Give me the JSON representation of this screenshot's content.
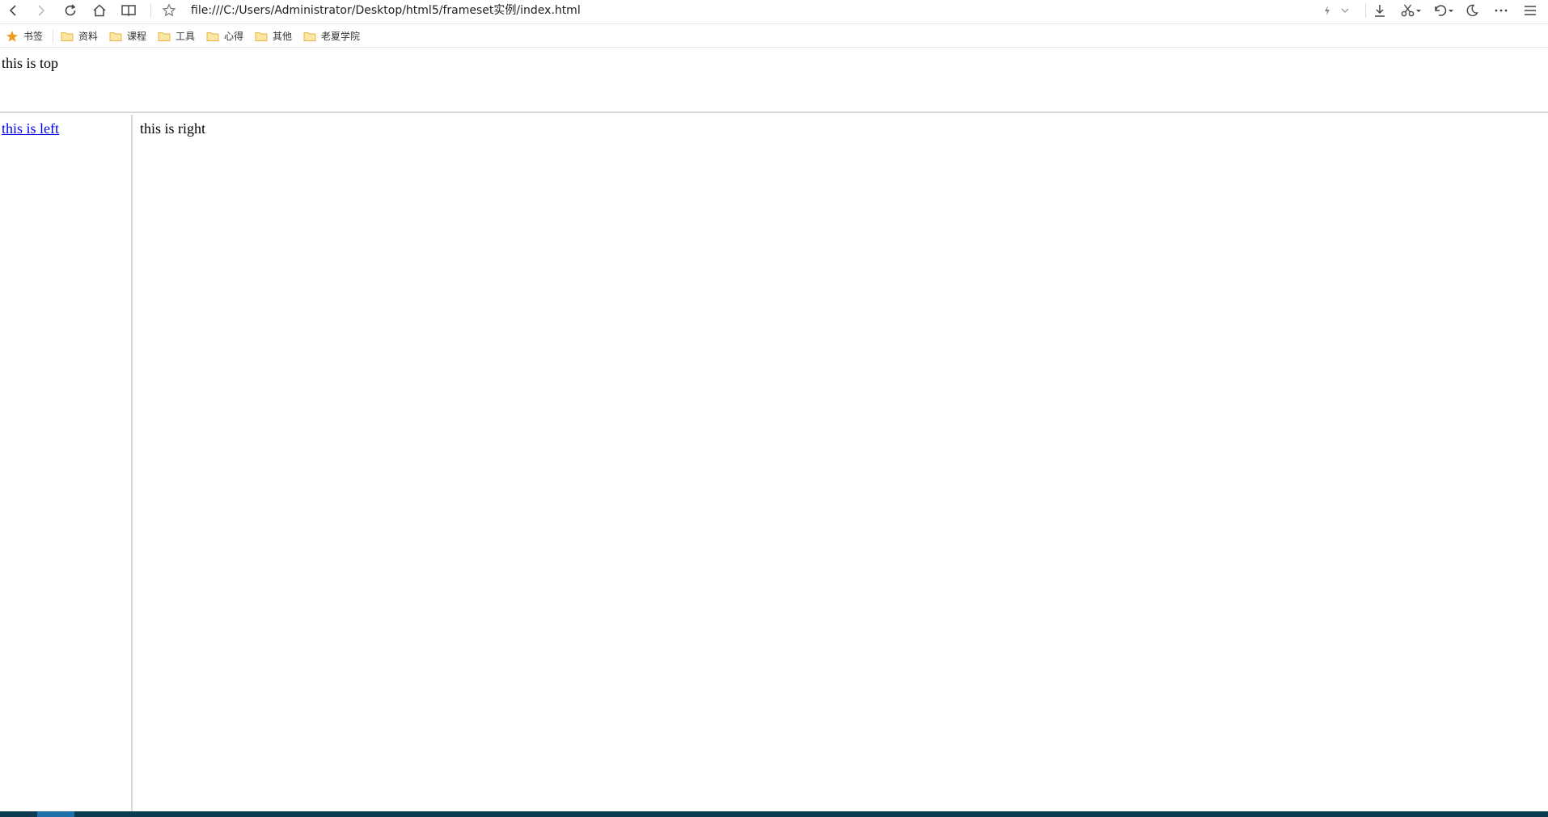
{
  "toolbar": {
    "address": "file:///C:/Users/Administrator/Desktop/html5/frameset实例/index.html",
    "icons": [
      "back-icon",
      "forward-icon",
      "reload-icon",
      "home-icon",
      "reader-icon",
      "star-icon",
      "lightning-icon",
      "chevron-down-icon",
      "download-icon",
      "scissors-icon",
      "undo-icon",
      "moon-icon",
      "more-icon",
      "menu-icon"
    ]
  },
  "bookmarks": {
    "label": "书签",
    "folders": [
      "资料",
      "课程",
      "工具",
      "心得",
      "其他",
      "老夏学院"
    ]
  },
  "frames": {
    "top": "this is top",
    "left_link": "this is left",
    "right": "this is right"
  },
  "colors": {
    "link": "#0000ee",
    "star": "#f29a1e",
    "folder": "#e8b53c",
    "taskbar": "#0d3b52"
  }
}
